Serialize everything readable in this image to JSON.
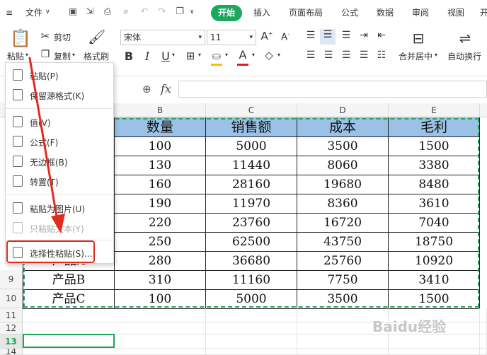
{
  "menubar": {
    "file_label": "文件",
    "tabs": [
      {
        "label": "开始",
        "active": true
      },
      {
        "label": "插入"
      },
      {
        "label": "页面布局"
      },
      {
        "label": "公式"
      },
      {
        "label": "数据"
      },
      {
        "label": "审阅"
      },
      {
        "label": "视图"
      },
      {
        "label": "开"
      }
    ],
    "accent": "#1aa85c"
  },
  "toolbar": {
    "paste_label": "粘贴",
    "cut_label": "剪切",
    "copy_label": "复制",
    "format_painter_label": "格式刷",
    "font_name": "宋体",
    "font_size": "11",
    "merge_label": "合并居中",
    "wrap_label": "自动换行",
    "bold": "B",
    "italic": "I",
    "underline": "U"
  },
  "formula_bar": {
    "fx": "fx",
    "value": ""
  },
  "paste_menu": [
    {
      "label": "粘贴(P)",
      "disabled": false
    },
    {
      "label": "保留源格式(K)",
      "disabled": false
    },
    {
      "label": "值(V)",
      "disabled": false
    },
    {
      "label": "公式(F)",
      "disabled": false
    },
    {
      "label": "无边框(B)",
      "disabled": false
    },
    {
      "label": "转置(T)",
      "disabled": false
    },
    {
      "label": "粘贴为图片(U)",
      "disabled": false
    },
    {
      "label": "只粘贴文本(Y)",
      "disabled": true
    },
    {
      "label": "选择性粘贴(S)...",
      "disabled": false,
      "highlighted": true
    }
  ],
  "grid": {
    "columns": [
      "B",
      "C",
      "D",
      "E"
    ],
    "row_numbers": [
      "9",
      "10",
      "11",
      "12",
      "13",
      "14"
    ],
    "header_row": [
      "数量",
      "销售额",
      "成本",
      "毛利"
    ],
    "rows": [
      {
        "a": "",
        "b": "100",
        "c": "5000",
        "d": "3500",
        "e": "1500"
      },
      {
        "a": "",
        "b": "130",
        "c": "11440",
        "d": "8060",
        "e": "3380"
      },
      {
        "a": "",
        "b": "160",
        "c": "28160",
        "d": "19680",
        "e": "8480"
      },
      {
        "a": "",
        "b": "190",
        "c": "11970",
        "d": "8360",
        "e": "3610"
      },
      {
        "a": "",
        "b": "220",
        "c": "23760",
        "d": "16720",
        "e": "7040"
      },
      {
        "a": "",
        "b": "250",
        "c": "62500",
        "d": "43750",
        "e": "18750"
      },
      {
        "a": "产品A",
        "b": "280",
        "c": "36680",
        "d": "25760",
        "e": "10920"
      },
      {
        "a": "产品B",
        "b": "310",
        "c": "11160",
        "d": "7750",
        "e": "3410"
      },
      {
        "a": "产品C",
        "b": "100",
        "c": "5000",
        "d": "3500",
        "e": "1500"
      }
    ],
    "header_fill": "#9bc2e6",
    "selection_color": "#2e9f63"
  },
  "watermark": "Baidu经验"
}
